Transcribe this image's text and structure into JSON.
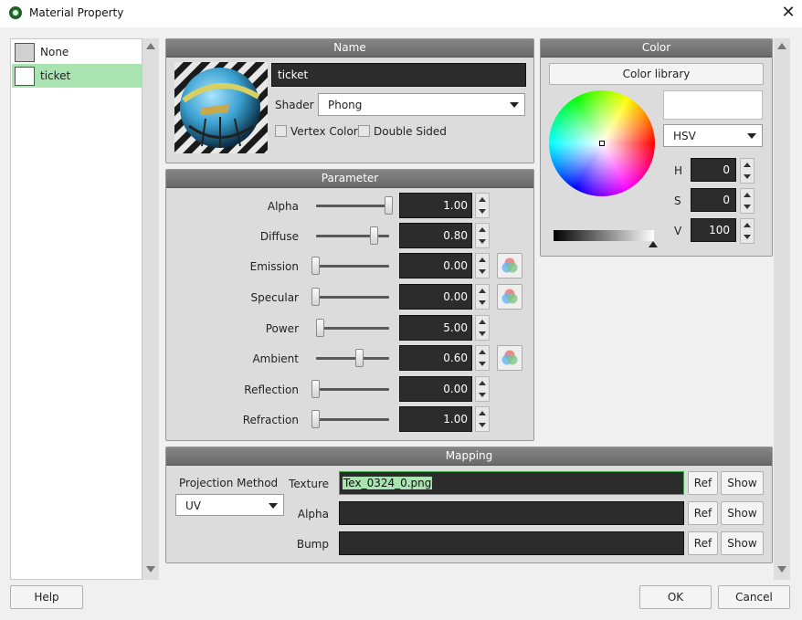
{
  "window": {
    "title": "Material Property"
  },
  "materials": [
    {
      "label": "None",
      "swatch": "#d0d0d0"
    },
    {
      "label": "ticket",
      "swatch": "#ffffff"
    }
  ],
  "name_group": {
    "header": "Name",
    "name_value": "ticket",
    "shader_label": "Shader",
    "shader_value": "Phong",
    "vertex_color_label": "Vertex Color",
    "double_sided_label": "Double Sided"
  },
  "parameter_group": {
    "header": "Parameter",
    "params": [
      {
        "label": "Alpha",
        "value": "1.00",
        "level": 1.0,
        "color_button": false
      },
      {
        "label": "Diffuse",
        "value": "0.80",
        "level": 0.8,
        "color_button": false
      },
      {
        "label": "Emission",
        "value": "0.00",
        "level": 0.0,
        "color_button": true
      },
      {
        "label": "Specular",
        "value": "0.00",
        "level": 0.0,
        "color_button": true
      },
      {
        "label": "Power",
        "value": "5.00",
        "level": 0.06,
        "color_button": false
      },
      {
        "label": "Ambient",
        "value": "0.60",
        "level": 0.6,
        "color_button": true
      },
      {
        "label": "Reflection",
        "value": "0.00",
        "level": 0.0,
        "color_button": false
      },
      {
        "label": "Refraction",
        "value": "1.00",
        "level": 0.0,
        "color_button": false
      }
    ]
  },
  "color_group": {
    "header": "Color",
    "library_button": "Color library",
    "mode_value": "HSV",
    "preview_color": "#ffffff",
    "h_label": "H",
    "h_value": "0",
    "s_label": "S",
    "s_value": "0",
    "v_label": "V",
    "v_value": "100"
  },
  "mapping_group": {
    "header": "Mapping",
    "projection_label": "Projection Method",
    "projection_value": "UV",
    "rows": [
      {
        "label": "Texture",
        "value": "Tex_0324_0.png",
        "ref": "Ref",
        "show": "Show"
      },
      {
        "label": "Alpha",
        "value": "",
        "ref": "Ref",
        "show": "Show"
      },
      {
        "label": "Bump",
        "value": "",
        "ref": "Ref",
        "show": "Show"
      }
    ]
  },
  "footer": {
    "help": "Help",
    "ok": "OK",
    "cancel": "Cancel"
  },
  "colors": {
    "selected_row": "#a9e4b0",
    "header_bg": "#7a7a7a",
    "field_bg": "#2c2c2c",
    "texture_border": "#3fae4b"
  }
}
